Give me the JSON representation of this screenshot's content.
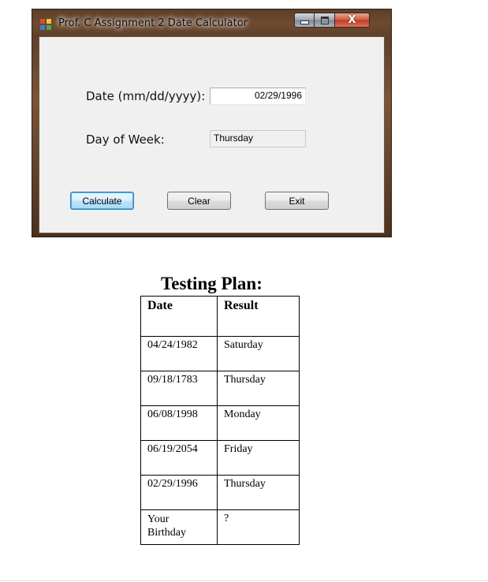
{
  "window": {
    "title": "Prof. C Assignment 2 Date Calculator",
    "caption_close": "X"
  },
  "form": {
    "date_label": "Date (mm/dd/yyyy):",
    "date_value": "02/29/1996",
    "day_label": "Day of Week:",
    "day_value": "Thursday",
    "buttons": {
      "calculate": "Calculate",
      "clear": "Clear",
      "exit": "Exit"
    }
  },
  "testing_plan": {
    "title": "Testing Plan:",
    "headers": [
      "Date",
      "Result"
    ],
    "rows": [
      {
        "date": "04/24/1982",
        "result": "Saturday"
      },
      {
        "date": "09/18/1783",
        "result": "Thursday"
      },
      {
        "date": "06/08/1998",
        "result": "Monday"
      },
      {
        "date": "06/19/2054",
        "result": "Friday"
      },
      {
        "date": "02/29/1996",
        "result": "Thursday"
      },
      {
        "date_line1": "Your",
        "date_line2": "Birthday",
        "result": "?"
      }
    ]
  }
}
